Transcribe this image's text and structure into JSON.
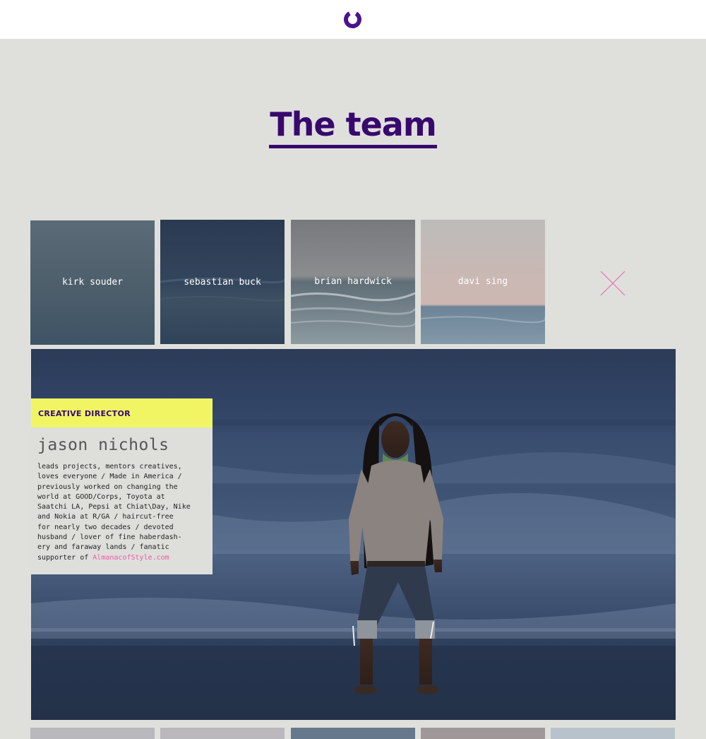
{
  "header": {
    "logo_icon": "ring-logo-icon",
    "brand_color": "#38086e"
  },
  "page": {
    "title": "The team"
  },
  "team_tiles": [
    {
      "name": "kirk souder"
    },
    {
      "name": "sebastian buck"
    },
    {
      "name": "brian hardwick"
    },
    {
      "name": "davi sing"
    }
  ],
  "close": {
    "icon": "close-x-icon",
    "color": "#e86fb3"
  },
  "featured": {
    "role": "CREATIVE DIRECTOR",
    "name": "jason nichols",
    "bio": "leads projects, mentors creatives,\nloves everyone / Made in America /\npreviously worked on changing the\nworld at GOOD/Corps, Toyota at\nSaatchi LA, Pepsi at Chiat\\Day, Nike\nand Nokia at R/GA / haircut-free\nfor nearly two decades / devoted\nhusband / lover of fine haberdash-\nery and faraway lands / fanatic\nsupporter of ",
    "link_text": "AlmanacofStyle.com",
    "accent_color": "#f1f563",
    "link_color": "#ec5aa8"
  }
}
